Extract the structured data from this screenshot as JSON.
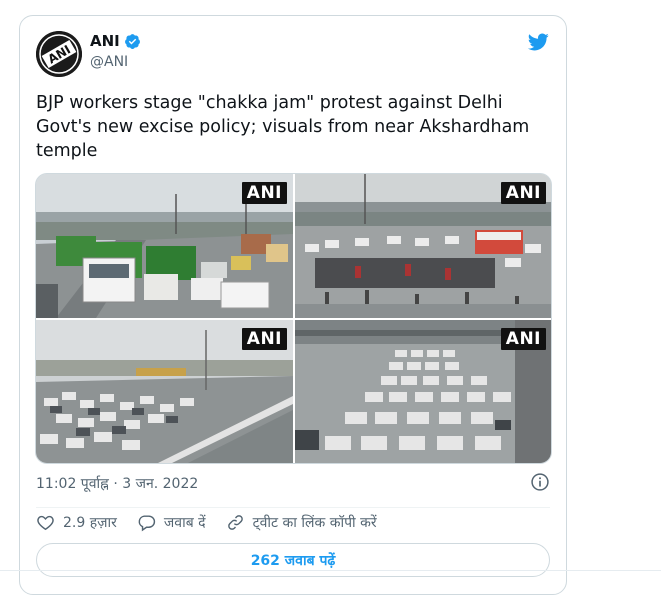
{
  "author": {
    "name": "ANI",
    "handle": "@ANI",
    "avatar_text": "ANI",
    "verified": true
  },
  "tweet": {
    "text": "BJP workers stage \"chakka jam\" protest against Delhi Govt's new excise policy; visuals from near Akshardham temple"
  },
  "media": {
    "watermark": "ANI",
    "images": [
      {
        "label": "ANI"
      },
      {
        "label": "ANI"
      },
      {
        "label": "ANI"
      },
      {
        "label": "ANI"
      }
    ]
  },
  "meta": {
    "timestamp": "11:02 पूर्वाह्न · 3 जन. 2022"
  },
  "actions": {
    "likes": "2.9 हज़ार",
    "reply_label": "जवाब दें",
    "copy_link_label": "ट्वीट का लिंक कॉपी करें"
  },
  "replies_button": "262 जवाब पढ़ें",
  "colors": {
    "accent": "#1d9bf0",
    "text": "#0f1419",
    "muted": "#536471",
    "border": "#cfd9de"
  }
}
